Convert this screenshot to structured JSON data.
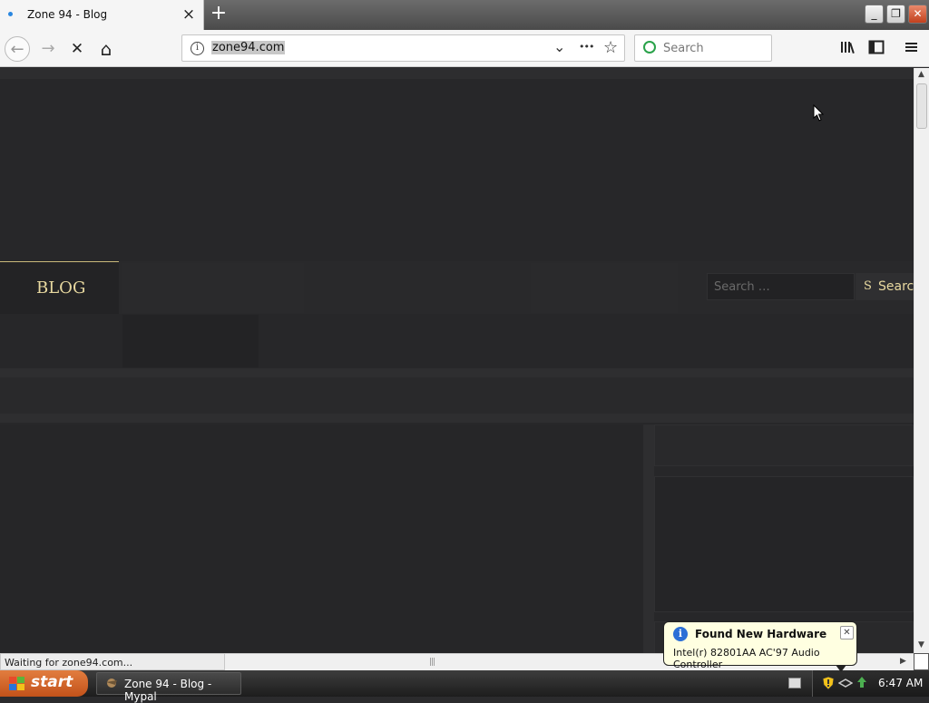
{
  "tab": {
    "title": "Zone 94 - Blog",
    "close": "×"
  },
  "window": {
    "minimize": "_",
    "restore": "❐",
    "close": "✕"
  },
  "nav": {
    "back": "←",
    "forward": "→",
    "stop": "✕",
    "home": "⌂",
    "url": "zone94.com",
    "search_placeholder": "Search",
    "more": "•••",
    "star": "☆",
    "dropdown": "⌄"
  },
  "site": {
    "nav_item": "BLOG",
    "search_placeholder": "Search …",
    "search_button": "Search",
    "search_button_accent": "S"
  },
  "status": {
    "text": "Waiting for zone94.com..."
  },
  "taskbar": {
    "start": "start",
    "task_title": "Zone 94 - Blog - Mypal",
    "clock": "6:47 AM"
  },
  "balloon": {
    "title": "Found New Hardware",
    "text": "Intel(r) 82801AA AC'97 Audio Controller",
    "close": "✕",
    "icon": "i"
  },
  "colors": {
    "page_bg": "#272729",
    "gold": "#e8d9a0",
    "accent_orange": "#c2521a"
  }
}
